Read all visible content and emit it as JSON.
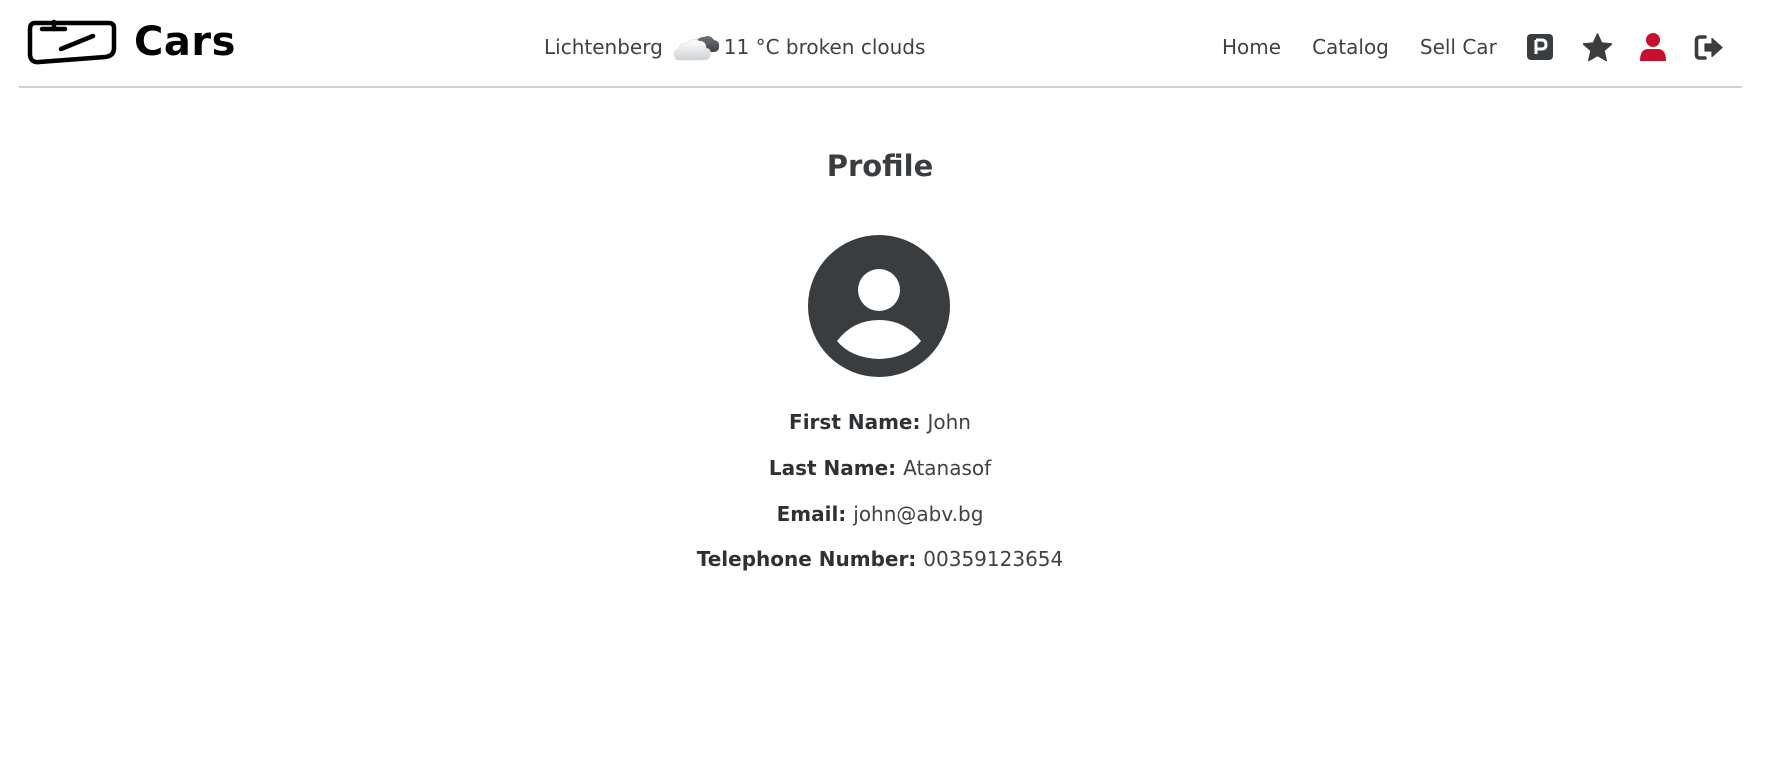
{
  "header": {
    "brand": "Cars",
    "weather": {
      "city": "Lichtenberg",
      "temperature": "11 °C",
      "condition": "broken clouds",
      "icon": "broken-clouds-icon"
    },
    "nav": {
      "home": "Home",
      "catalog": "Catalog",
      "sell_car": "Sell Car",
      "icons": [
        "parking-icon",
        "star-icon",
        "user-icon",
        "logout-icon"
      ],
      "active_icon_color": "#c8102e"
    }
  },
  "profile": {
    "title": "Profile",
    "avatar_icon": "user-circle-icon",
    "fields": {
      "first_name": {
        "label": "First Name:",
        "value": "John"
      },
      "last_name": {
        "label": "Last Name:",
        "value": "Atanasof"
      },
      "email": {
        "label": "Email:",
        "value": "john@abv.bg"
      },
      "telephone": {
        "label": "Telephone Number:",
        "value": "00359123654"
      }
    }
  },
  "colors": {
    "text": "#3f4245",
    "icon_dark": "#393d40",
    "accent_red": "#c8102e",
    "divider": "#cfcfcf"
  }
}
